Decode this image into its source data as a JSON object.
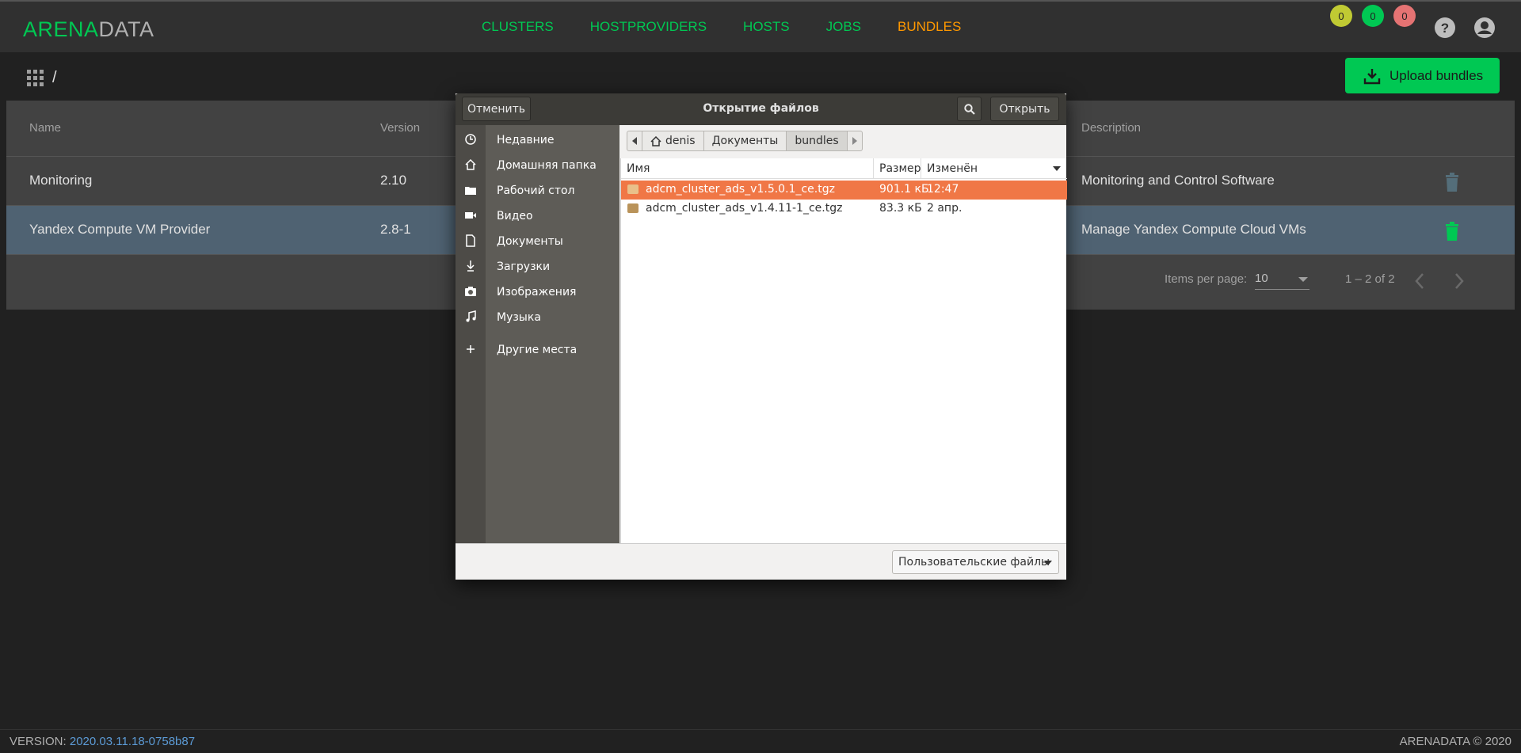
{
  "app": {
    "logo_part1": "ARENA",
    "logo_part2": "DATA"
  },
  "nav": {
    "items": [
      "CLUSTERS",
      "HOSTPROVIDERS",
      "HOSTS",
      "JOBS",
      "BUNDLES"
    ],
    "active": "BUNDLES"
  },
  "badges": [
    "0",
    "0",
    "0"
  ],
  "breadcrumb": "/",
  "upload_button": "Upload bundles",
  "table": {
    "headers": {
      "name": "Name",
      "version": "Version",
      "description": "Description"
    },
    "rows": [
      {
        "name": "Monitoring",
        "version": "2.10",
        "description": "Monitoring and Control Software"
      },
      {
        "name": "Yandex Compute VM Provider",
        "version": "2.8-1",
        "description": "Manage Yandex Compute Cloud VMs"
      }
    ],
    "items_per_page_label": "Items per page:",
    "items_per_page": "10",
    "range": "1 – 2 of 2"
  },
  "dialog": {
    "title": "Открытие файлов",
    "cancel": "Отменить",
    "open": "Открыть",
    "sidebar": [
      "Недавние",
      "Домашняя папка",
      "Рабочий стол",
      "Видео",
      "Документы",
      "Загрузки",
      "Изображения",
      "Музыка",
      "Другие места"
    ],
    "path": [
      "denis",
      "Документы",
      "bundles"
    ],
    "columns": {
      "name": "Имя",
      "size": "Размер",
      "modified": "Изменён"
    },
    "files": [
      {
        "name": "adcm_cluster_ads_v1.5.0.1_ce.tgz",
        "size": "901.1 кБ",
        "modified": "12:47"
      },
      {
        "name": "adcm_cluster_ads_v1.4.11-1_ce.tgz",
        "size": "83.3 кБ",
        "modified": "2 апр."
      }
    ],
    "filter": "Пользовательские файлы"
  },
  "footer": {
    "version_label": "VERSION: ",
    "version": "2020.03.11.18-0758b87",
    "copyright": "ARENADATA © 2020"
  },
  "colors": {
    "accent_green": "#00c853",
    "active_orange": "#ff9800",
    "selection_orange": "#f07746"
  }
}
